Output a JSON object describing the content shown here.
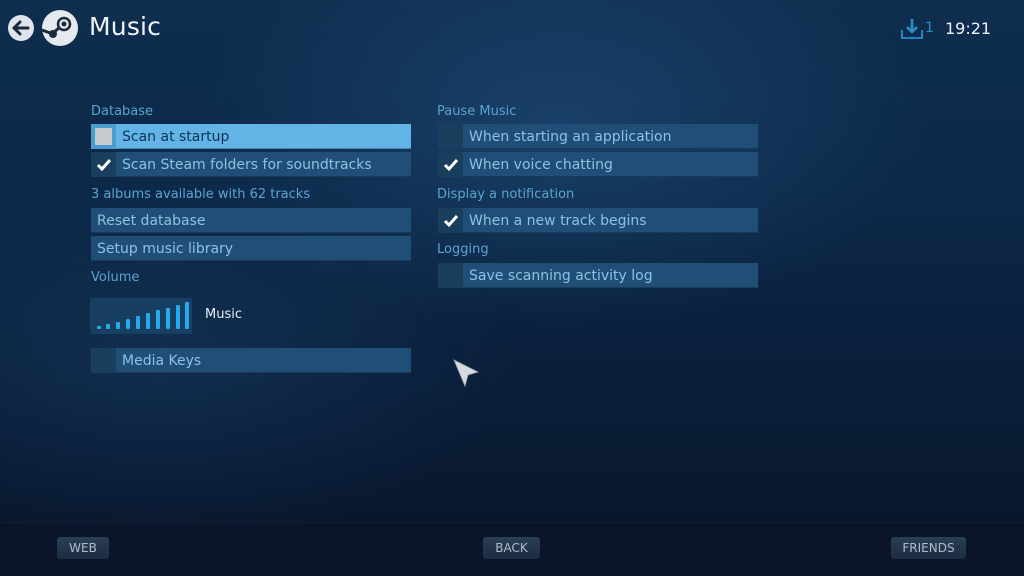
{
  "header": {
    "title": "Music",
    "back_icon": "back-arrow-icon",
    "logo_icon": "steam-logo-icon",
    "downloads_icon": "download-icon",
    "downloads_count": "1",
    "clock": "19:21"
  },
  "database": {
    "label": "Database",
    "options": [
      {
        "label": "Scan at startup",
        "checked": false,
        "focused": true
      },
      {
        "label": "Scan Steam folders for soundtracks",
        "checked": true,
        "focused": false
      }
    ],
    "info": "3 albums available with 62 tracks",
    "buttons": [
      {
        "label": "Reset database"
      },
      {
        "label": "Setup music library"
      }
    ]
  },
  "volume": {
    "label": "Volume",
    "level": "10/10",
    "channel_label": "Music"
  },
  "media_keys": {
    "label": "Media Keys",
    "checked": false
  },
  "pause_music": {
    "label": "Pause Music",
    "options": [
      {
        "label": "When starting an application",
        "checked": false
      },
      {
        "label": "When voice chatting",
        "checked": true
      }
    ]
  },
  "notification": {
    "label": "Display a notification",
    "options": [
      {
        "label": "When a new track begins",
        "checked": true
      }
    ]
  },
  "logging": {
    "label": "Logging",
    "options": [
      {
        "label": "Save scanning activity log",
        "checked": false
      }
    ]
  },
  "footer": {
    "web": "WEB",
    "back": "BACK",
    "friends": "FRIENDS"
  },
  "colors": {
    "accent": "#62b4e6",
    "row_bg": "#1f4f77",
    "label_text": "#5aa4d0",
    "volume_bar": "#22aaea"
  }
}
